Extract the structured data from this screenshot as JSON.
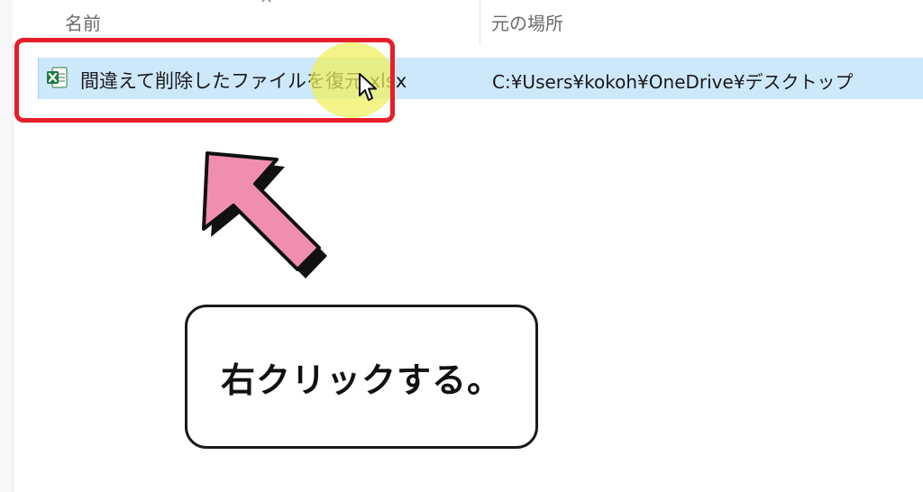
{
  "header": {
    "name_column": "名前",
    "location_column": "元の場所"
  },
  "file_row": {
    "name": "間違えて削除したファイルを復元.xlsx",
    "location": "C:¥Users¥kokoh¥OneDrive¥デスクトップ",
    "icon": "excel-icon"
  },
  "annotation": {
    "callout_text": "右クリックする。",
    "highlight_color": "#e61e2a",
    "arrow_color": "#ef8fad"
  }
}
